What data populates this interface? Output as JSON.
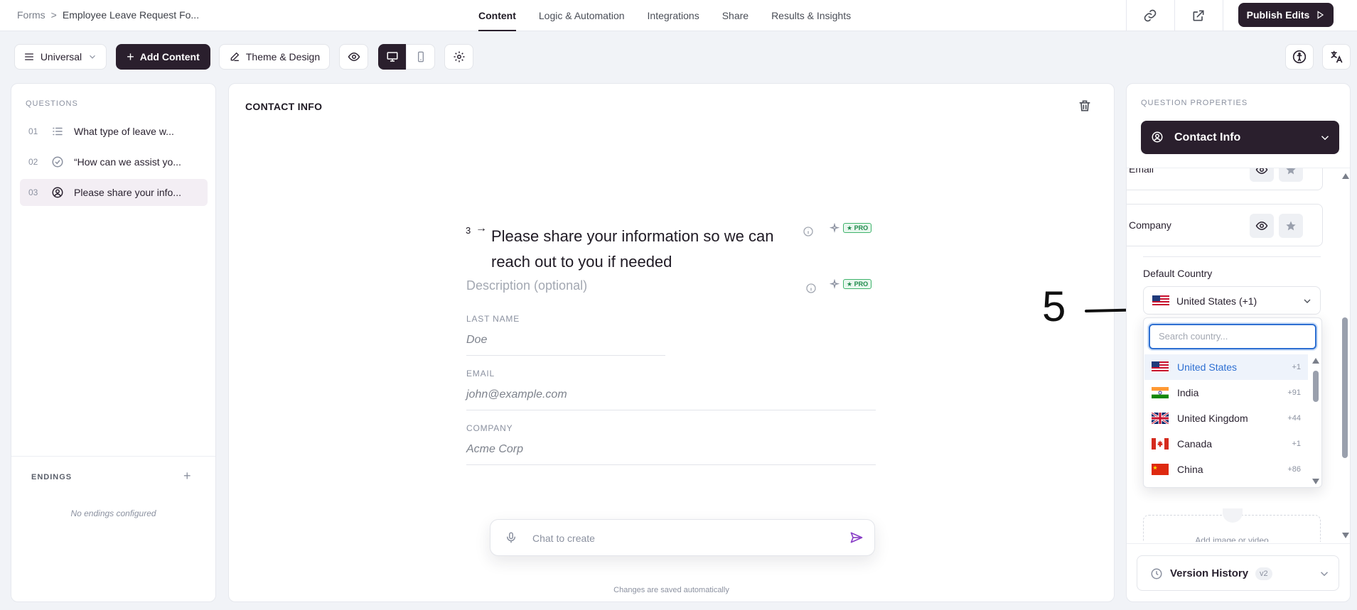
{
  "breadcrumb": {
    "root": "Forms",
    "separator": ">",
    "current": "Employee Leave Request Fo..."
  },
  "nav_tabs": [
    {
      "label": "Content",
      "active": true
    },
    {
      "label": "Logic & Automation"
    },
    {
      "label": "Integrations"
    },
    {
      "label": "Share"
    },
    {
      "label": "Results & Insights"
    }
  ],
  "publish_label": "Publish Edits",
  "toolbar": {
    "mode_label": "Universal",
    "add_content_label": "Add Content",
    "theme_label": "Theme & Design"
  },
  "questions": {
    "section_label": "QUESTIONS",
    "items": [
      {
        "num": "01",
        "icon": "list-icon",
        "label": "What type of leave w..."
      },
      {
        "num": "02",
        "icon": "check-circle-icon",
        "label": "“How can we assist yo..."
      },
      {
        "num": "03",
        "icon": "user-circle-icon",
        "label": "Please share your info...",
        "active": true
      }
    ],
    "endings_label": "ENDINGS",
    "no_endings": "No endings configured"
  },
  "editor": {
    "block_title": "CONTACT INFO",
    "q_number": "3",
    "q_arrow": "→",
    "q_text_line1": "Please share your information so we can",
    "q_text_line2": "reach out to you if needed",
    "pro_label": "★ PRO",
    "description_placeholder": "Description (optional)",
    "fields": [
      {
        "label": "LAST NAME",
        "placeholder": "Doe"
      },
      {
        "label": "EMAIL",
        "placeholder": "john@example.com"
      },
      {
        "label": "COMPANY",
        "placeholder": "Acme Corp"
      }
    ],
    "chat_placeholder": "Chat to create",
    "autosave_note": "Changes are saved automatically"
  },
  "properties": {
    "section_label": "QUESTION PROPERTIES",
    "type_label": "Contact Info",
    "field_cards": [
      {
        "label": "Email"
      },
      {
        "label": "Company"
      }
    ],
    "default_country_label": "Default Country",
    "selected_country": "United States (+1)",
    "search_placeholder": "Search country...",
    "countries": [
      {
        "name": "United States",
        "code": "+1",
        "highlighted": true
      },
      {
        "name": "India",
        "code": "+91"
      },
      {
        "name": "United Kingdom",
        "code": "+44"
      },
      {
        "name": "Canada",
        "code": "+1"
      },
      {
        "name": "China",
        "code": "+86"
      }
    ],
    "media_label": "Add image or video",
    "version_history_label": "Version History",
    "version_badge": "v2"
  },
  "annotation": {
    "step_number": "5"
  },
  "colors": {
    "brand_dark": "#2a1f2d",
    "accent_blue": "#2d6fd2",
    "pro_green": "#1f8a4c"
  }
}
